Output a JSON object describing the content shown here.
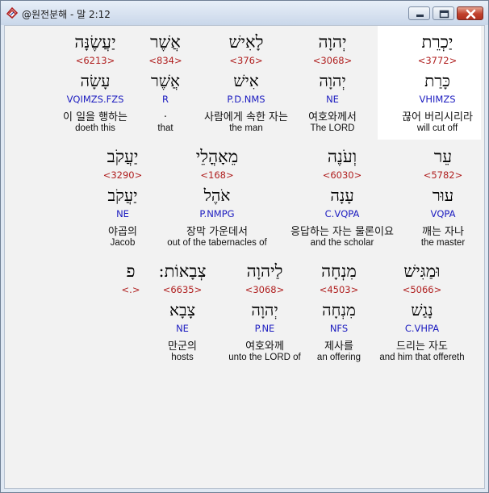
{
  "window": {
    "title": "@원전분해 - 말 2:12",
    "controls": [
      "minimize",
      "maximize",
      "close"
    ]
  },
  "rows": [
    {
      "words": [
        {
          "hebrew": "יַכְרֵת",
          "strong": "<3772>",
          "lemma": "כָּרַת",
          "morph": "VHIMZS",
          "korean": "끊어 버리시리라",
          "english": "will cut off",
          "highlighted": true
        },
        {
          "hebrew": "יְהוָה",
          "strong": "<3068>",
          "lemma": "יְהוָה",
          "morph": "NE",
          "korean": "여호와께서",
          "english": "The LORD"
        },
        {
          "hebrew": "לָאִישׁ",
          "strong": "<376>",
          "lemma": "אִישׁ",
          "morph": "P.D.NMS",
          "korean": "사람에게 속한 자는",
          "english": "the man"
        },
        {
          "hebrew": "אֲשֶׁר",
          "strong": "<834>",
          "lemma": "אֲשֶׁר",
          "morph": "R",
          "korean": ".",
          "english": "that"
        },
        {
          "hebrew": "יַעֲשֶׂנָּה",
          "strong": "<6213>",
          "lemma": "עָשָׂה",
          "morph": "VQIMZS.FZS",
          "korean": "이 일을 행하는",
          "english": "doeth this"
        }
      ]
    },
    {
      "words": [
        {
          "hebrew": "עֵר",
          "strong": "<5782>",
          "lemma": "עוּר",
          "morph": "VQPA",
          "korean": "깨는 자나",
          "english": "the master"
        },
        {
          "hebrew": "וְעֹנֶה",
          "strong": "<6030>",
          "lemma": "עָנָה",
          "morph": "C.VQPA",
          "korean": "응답하는 자는 물론이요",
          "english": "and the scholar"
        },
        {
          "hebrew": "מֵאָהֳלֵי",
          "strong": "<168>",
          "lemma": "אֹהֶל",
          "morph": "P.NMPG",
          "korean": "장막 가운데서",
          "english": "out of the tabernacles of"
        },
        {
          "hebrew": "יַעֲקֹב",
          "strong": "<3290>",
          "lemma": "יַעֲקֹב",
          "morph": "NE",
          "korean": "야곱의",
          "english": "Jacob"
        }
      ]
    },
    {
      "words": [
        {
          "hebrew": "וּמַגִּישׁ",
          "strong": "<5066>",
          "lemma": "נָגַשׁ",
          "morph": "C.VHPA",
          "korean": "드리는 자도",
          "english": "and him that offereth"
        },
        {
          "hebrew": "מִנְחָה",
          "strong": "<4503>",
          "lemma": "מִנְחָה",
          "morph": "NFS",
          "korean": "제사를",
          "english": "an offering"
        },
        {
          "hebrew": "לַיהוָה",
          "strong": "<3068>",
          "lemma": "יְהוָה",
          "morph": "P.NE",
          "korean": "여호와께",
          "english": "unto the LORD of"
        },
        {
          "hebrew": "צְבָאוֹת:",
          "strong": "<6635>",
          "lemma": "צָבָא",
          "morph": "NE",
          "korean": "만군의",
          "english": "hosts"
        },
        {
          "hebrew": "פ",
          "strong": "<.>",
          "lemma": "",
          "morph": "",
          "korean": "",
          "english": ""
        }
      ]
    }
  ]
}
